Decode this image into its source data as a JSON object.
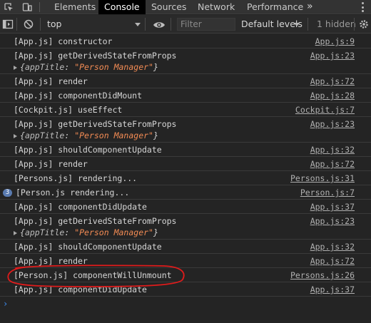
{
  "tabs": [
    {
      "label": "Elements",
      "active": false
    },
    {
      "label": "Console",
      "active": true
    },
    {
      "label": "Sources",
      "active": false
    },
    {
      "label": "Network",
      "active": false
    },
    {
      "label": "Performance",
      "active": false
    }
  ],
  "more_tabs_label": "»",
  "toolbar": {
    "context": "top",
    "filter_placeholder": "Filter",
    "levels_label": "Default levels",
    "hidden_label": "1 hidden"
  },
  "logs": [
    {
      "text": "[App.js] constructor",
      "source": "App.js:9"
    },
    {
      "text": "[App.js] getDerivedStateFromProps",
      "source": "App.js:23",
      "object": {
        "prefix": "{",
        "key": "appTitle",
        "sep": ": ",
        "value": "\"Person Manager\"",
        "suffix": "}"
      }
    },
    {
      "text": "[App.js] render",
      "source": "App.js:72"
    },
    {
      "text": "[App.js] componentDidMount",
      "source": "App.js:28"
    },
    {
      "text": "[Cockpit.js] useEffect",
      "source": "Cockpit.js:7"
    },
    {
      "text": "[App.js] getDerivedStateFromProps",
      "source": "App.js:23",
      "object": {
        "prefix": "{",
        "key": "appTitle",
        "sep": ": ",
        "value": "\"Person Manager\"",
        "suffix": "}"
      }
    },
    {
      "text": "[App.js] shouldComponentUpdate",
      "source": "App.js:32"
    },
    {
      "text": "[App.js] render",
      "source": "App.js:72"
    },
    {
      "text": "[Persons.js] rendering...",
      "source": "Persons.js:31"
    },
    {
      "text": "[Person.js rendering...",
      "source": "Person.js:7",
      "count": "3"
    },
    {
      "text": "[App.js] componentDidUpdate",
      "source": "App.js:37"
    },
    {
      "text": "[App.js] getDerivedStateFromProps",
      "source": "App.js:23",
      "object": {
        "prefix": "{",
        "key": "appTitle",
        "sep": ": ",
        "value": "\"Person Manager\"",
        "suffix": "}"
      }
    },
    {
      "text": "[App.js] shouldComponentUpdate",
      "source": "App.js:32"
    },
    {
      "text": "[App.js] render",
      "source": "App.js:72"
    },
    {
      "text": "[Person.js] componentWillUnmount",
      "source": "Persons.js:26",
      "highlighted": true
    },
    {
      "text": "[App.js] componentDidUpdate",
      "source": "App.js:37"
    }
  ],
  "prompt_symbol": "›",
  "colors": {
    "background": "#242424",
    "tab_active": "#000000",
    "string_value": "#f28b54",
    "prompt": "#3d8df2",
    "annotation": "#e01b1b",
    "count_badge": "#5a7bb0"
  },
  "icons": [
    "inspect-element-icon",
    "device-toolbar-icon",
    "sidebar-toggle-icon",
    "clear-console-icon",
    "live-expression-eye-icon",
    "settings-menu-icon"
  ]
}
